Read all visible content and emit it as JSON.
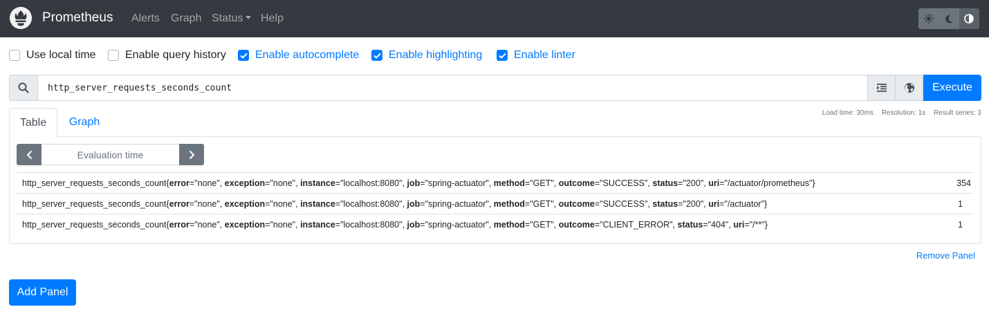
{
  "navbar": {
    "brand": "Prometheus",
    "links": {
      "alerts": "Alerts",
      "graph": "Graph",
      "status": "Status",
      "help": "Help"
    },
    "theme_buttons": [
      "sun-icon",
      "moon-icon",
      "half-circle-icon"
    ]
  },
  "options": {
    "local_time": {
      "label": "Use local time",
      "checked": false
    },
    "query_history": {
      "label": "Enable query history",
      "checked": false
    },
    "autocomplete": {
      "label": "Enable autocomplete",
      "checked": true
    },
    "highlighting": {
      "label": "Enable highlighting",
      "checked": true
    },
    "linter": {
      "label": "Enable linter",
      "checked": true
    }
  },
  "expression": {
    "value": "http_server_requests_seconds_count",
    "execute_label": "Execute"
  },
  "stats": {
    "load_time": "Load time: 30ms",
    "resolution": "Resolution: 1s",
    "result_series": "Result series: 3"
  },
  "tabs": {
    "table": "Table",
    "graph": "Graph"
  },
  "eval_time_placeholder": "Evaluation time",
  "results": [
    {
      "metric": "http_server_requests_seconds_count",
      "labels": [
        [
          "error",
          "none"
        ],
        [
          "exception",
          "none"
        ],
        [
          "instance",
          "localhost:8080"
        ],
        [
          "job",
          "spring-actuator"
        ],
        [
          "method",
          "GET"
        ],
        [
          "outcome",
          "SUCCESS"
        ],
        [
          "status",
          "200"
        ],
        [
          "uri",
          "/actuator/prometheus"
        ]
      ],
      "value": "354"
    },
    {
      "metric": "http_server_requests_seconds_count",
      "labels": [
        [
          "error",
          "none"
        ],
        [
          "exception",
          "none"
        ],
        [
          "instance",
          "localhost:8080"
        ],
        [
          "job",
          "spring-actuator"
        ],
        [
          "method",
          "GET"
        ],
        [
          "outcome",
          "SUCCESS"
        ],
        [
          "status",
          "200"
        ],
        [
          "uri",
          "/actuator"
        ]
      ],
      "value": "1"
    },
    {
      "metric": "http_server_requests_seconds_count",
      "labels": [
        [
          "error",
          "none"
        ],
        [
          "exception",
          "none"
        ],
        [
          "instance",
          "localhost:8080"
        ],
        [
          "job",
          "spring-actuator"
        ],
        [
          "method",
          "GET"
        ],
        [
          "outcome",
          "CLIENT_ERROR"
        ],
        [
          "status",
          "404"
        ],
        [
          "uri",
          "/**"
        ]
      ],
      "value": "1"
    }
  ],
  "remove_panel": "Remove Panel",
  "add_panel": "Add Panel",
  "colors": {
    "navbar_bg": "#343a40",
    "primary": "#007bff",
    "secondary": "#6c757d"
  }
}
